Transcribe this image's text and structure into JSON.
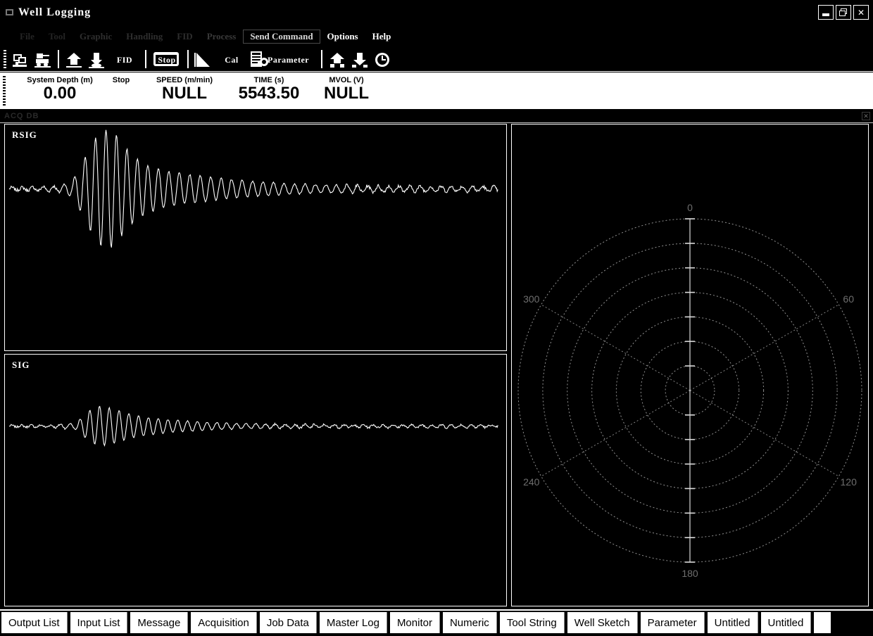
{
  "window": {
    "title": "Well Logging",
    "icon": "app-window-icon",
    "controls": {
      "minimize": "minimize-icon",
      "restore": "restore-icon",
      "close": "close-icon"
    }
  },
  "menu": {
    "items": [
      {
        "label": "File",
        "state": "dim"
      },
      {
        "label": "Tool",
        "state": "dim"
      },
      {
        "label": "Graphic",
        "state": "dim"
      },
      {
        "label": "Handling",
        "state": "dim"
      },
      {
        "label": "FID",
        "state": "dim"
      },
      {
        "label": "Process",
        "state": "dim"
      },
      {
        "label": "Send Command",
        "state": "boxed"
      },
      {
        "label": "Options",
        "state": "bright"
      },
      {
        "label": "Help",
        "state": "bright"
      }
    ]
  },
  "toolbar": {
    "buttons": [
      {
        "name": "connect-tool-icon",
        "label": ""
      },
      {
        "name": "truck-winch-icon",
        "label": ""
      },
      {
        "name": "tool-up-icon",
        "label": ""
      },
      {
        "name": "tool-down-icon",
        "label": ""
      },
      {
        "name": "fid-icon",
        "label": ""
      },
      {
        "name": "stop-button",
        "label": "Stop"
      },
      {
        "name": "depth-wedge-icon",
        "label": ""
      },
      {
        "name": "cal-button",
        "label": "Cal"
      },
      {
        "name": "parameter-button",
        "label": "Parameter"
      },
      {
        "name": "tool-up2-icon",
        "label": ""
      },
      {
        "name": "tool-down2-icon",
        "label": ""
      },
      {
        "name": "clock-icon",
        "label": ""
      }
    ],
    "stop_label": "Stop",
    "cal_label": "Cal",
    "parameter_label": "Parameter"
  },
  "readout": {
    "fields": [
      {
        "label": "System Depth (m)",
        "value": "0.00"
      },
      {
        "label": "Stop",
        "value": ""
      },
      {
        "label": "SPEED (m/min)",
        "value": "NULL"
      },
      {
        "label": "TIME (s)",
        "value": "5543.50"
      },
      {
        "label": "MVOL (V)",
        "value": "NULL"
      }
    ]
  },
  "mdi": {
    "title": "ACQ DB",
    "close_icon": "close-icon"
  },
  "panels": {
    "rsig": {
      "label": "RSIG"
    },
    "sig": {
      "label": "SIG"
    },
    "polar": {
      "label": ""
    }
  },
  "tabs": {
    "items": [
      "Output List",
      "Input List",
      "Message",
      "Acquisition",
      "Job Data",
      "Master Log",
      "Monitor",
      "Numeric",
      "Tool String",
      "Well Sketch",
      "Parameter",
      "Untitled",
      "Untitled"
    ]
  },
  "colors": {
    "background": "#000000",
    "foreground": "#ffffff",
    "readout_bg": "#ffffff",
    "trace": "#ffffff",
    "grid": "#909090"
  },
  "chart_data": [
    {
      "type": "line",
      "name": "RSIG",
      "title": "RSIG",
      "xlabel": "",
      "ylabel": "",
      "grid": false,
      "legend": "none",
      "description": "Damped acoustic waveform: flat baseline, rising burst peaking near sample 110-170, then decaying ringdown to the right.",
      "envelope": [
        {
          "x": 0,
          "a": 0.02
        },
        {
          "x": 40,
          "a": 0.03
        },
        {
          "x": 70,
          "a": 0.05
        },
        {
          "x": 90,
          "a": 0.12
        },
        {
          "x": 105,
          "a": 0.42
        },
        {
          "x": 120,
          "a": 0.78
        },
        {
          "x": 135,
          "a": 0.98
        },
        {
          "x": 150,
          "a": 0.95
        },
        {
          "x": 165,
          "a": 0.7
        },
        {
          "x": 180,
          "a": 0.52
        },
        {
          "x": 200,
          "a": 0.38
        },
        {
          "x": 225,
          "a": 0.3
        },
        {
          "x": 255,
          "a": 0.24
        },
        {
          "x": 290,
          "a": 0.19
        },
        {
          "x": 330,
          "a": 0.14
        },
        {
          "x": 380,
          "a": 0.1
        },
        {
          "x": 440,
          "a": 0.07
        },
        {
          "x": 520,
          "a": 0.05
        },
        {
          "x": 620,
          "a": 0.04
        },
        {
          "x": 700,
          "a": 0.04
        }
      ],
      "period": 15,
      "xlim": [
        0,
        700
      ],
      "ylim": [
        -1,
        1
      ]
    },
    {
      "type": "line",
      "name": "SIG",
      "title": "SIG",
      "xlabel": "",
      "ylabel": "",
      "grid": false,
      "legend": "none",
      "description": "Lower amplitude companion waveform: short burst near sample 110-200 then long low-amplitude tail.",
      "envelope": [
        {
          "x": 0,
          "a": 0.02
        },
        {
          "x": 60,
          "a": 0.03
        },
        {
          "x": 95,
          "a": 0.08
        },
        {
          "x": 115,
          "a": 0.4
        },
        {
          "x": 130,
          "a": 0.52
        },
        {
          "x": 150,
          "a": 0.44
        },
        {
          "x": 175,
          "a": 0.3
        },
        {
          "x": 200,
          "a": 0.22
        },
        {
          "x": 235,
          "a": 0.16
        },
        {
          "x": 280,
          "a": 0.11
        },
        {
          "x": 330,
          "a": 0.07
        },
        {
          "x": 400,
          "a": 0.05
        },
        {
          "x": 480,
          "a": 0.04
        },
        {
          "x": 560,
          "a": 0.035
        },
        {
          "x": 640,
          "a": 0.04
        },
        {
          "x": 700,
          "a": 0.03
        }
      ],
      "period": 14,
      "xlim": [
        0,
        700
      ],
      "ylim": [
        -1,
        1
      ]
    },
    {
      "type": "polar",
      "name": "polar-grid",
      "title": "",
      "angle_ticks": [
        0,
        60,
        120,
        180,
        240,
        300
      ],
      "angle_tick_labels": [
        "0",
        "60",
        "120",
        "180",
        "240",
        "300"
      ],
      "rings": 7,
      "radial_values": [
        1,
        2,
        3,
        4,
        5,
        6,
        7
      ],
      "series": [],
      "grid": true,
      "legend": "none",
      "description": "Empty polar / compass grid with 7 concentric dashed rings and 6 radial spokes labelled in degrees; solid vertical 0-180 axis with tick marks."
    }
  ]
}
